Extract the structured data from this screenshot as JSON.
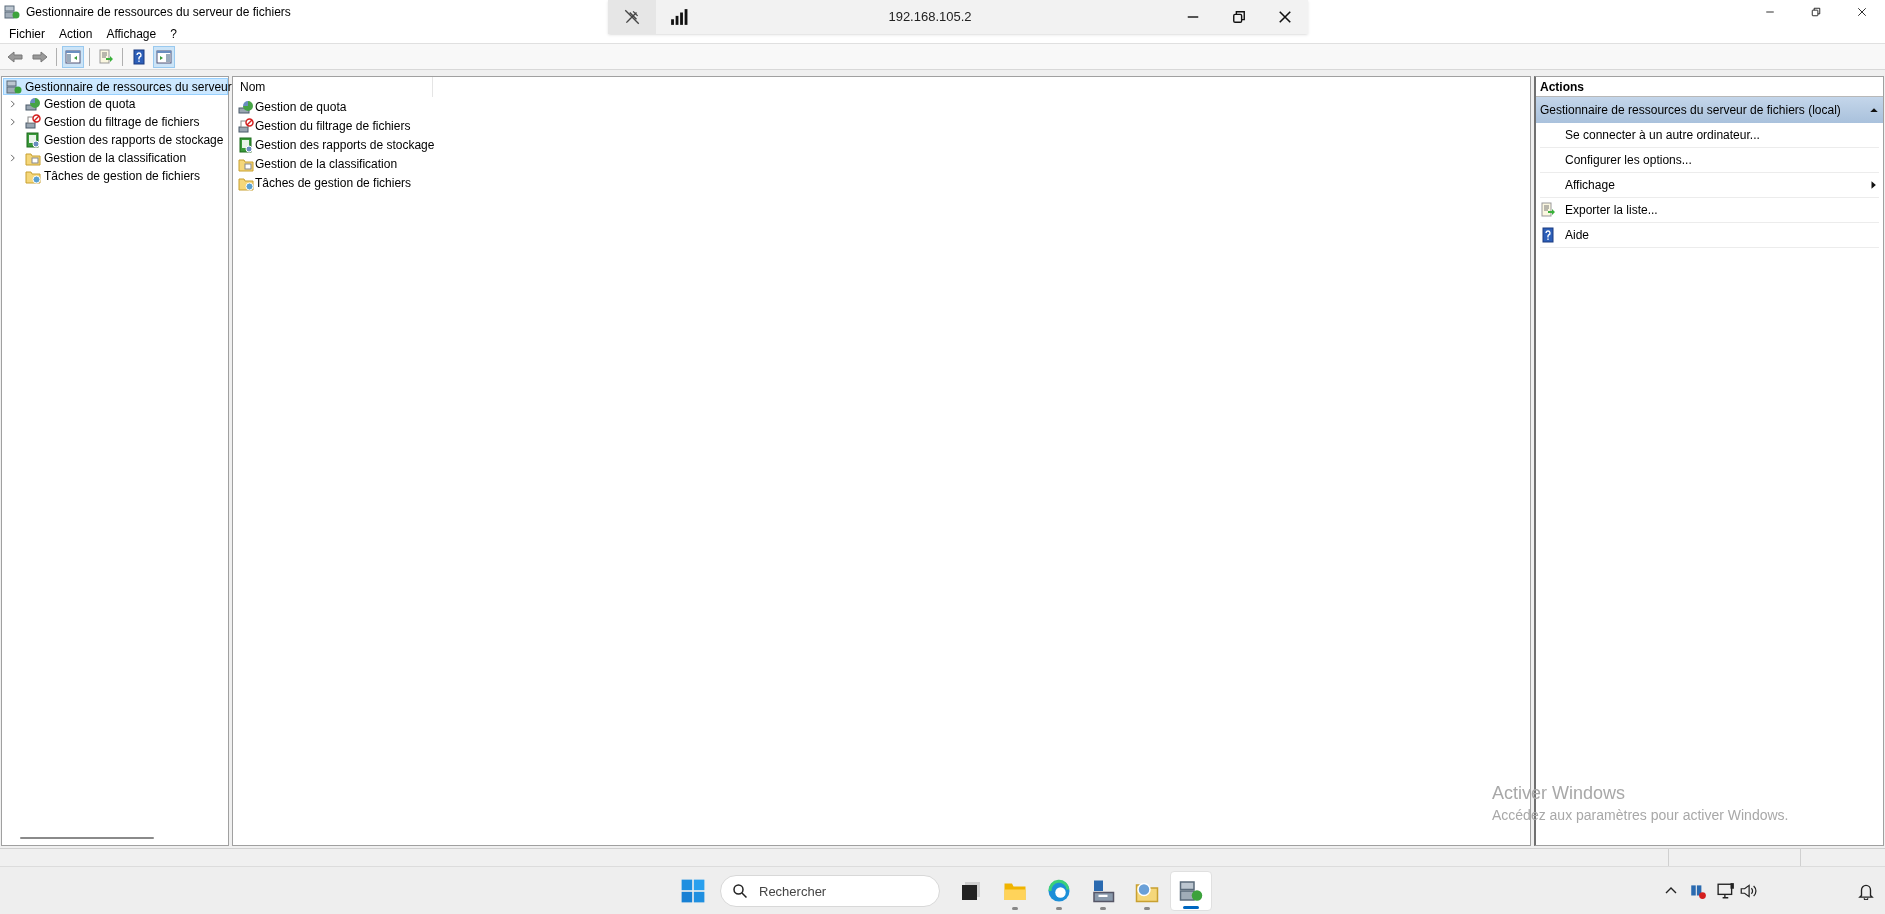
{
  "window": {
    "title": "Gestionnaire de ressources du serveur de fichiers"
  },
  "connection_bar": {
    "address": "192.168.105.2"
  },
  "menu": [
    "Fichier",
    "Action",
    "Affichage",
    "?"
  ],
  "toolbar": [
    {
      "kind": "back",
      "pressed": false
    },
    {
      "kind": "forward",
      "pressed": false
    },
    {
      "kind": "show-tree",
      "pressed": true
    },
    {
      "kind": "export",
      "pressed": false
    },
    {
      "kind": "help",
      "pressed": false
    },
    {
      "kind": "show-actions",
      "pressed": true
    }
  ],
  "tree": {
    "label": "Gestionnaire de ressources du serveur",
    "kind": "server",
    "selected": true,
    "children": [
      {
        "label": "Gestion de quota",
        "kind": "quota",
        "selected": false,
        "expandable": true
      },
      {
        "label": "Gestion du filtrage de fichiers",
        "kind": "filter",
        "selected": false,
        "expandable": true
      },
      {
        "label": "Gestion des rapports de stockage",
        "kind": "report",
        "selected": false,
        "expandable": false
      },
      {
        "label": "Gestion de la classification",
        "kind": "classification",
        "selected": false,
        "expandable": true
      },
      {
        "label": "Tâches de gestion de fichiers",
        "kind": "tasks",
        "selected": false,
        "expandable": false
      }
    ]
  },
  "list": {
    "columns": [
      "Nom"
    ],
    "rows": [
      {
        "name": "Gestion de quota",
        "kind": "quota"
      },
      {
        "name": "Gestion du filtrage de fichiers",
        "kind": "filter"
      },
      {
        "name": "Gestion des rapports de stockage",
        "kind": "report"
      },
      {
        "name": "Gestion de la classification",
        "kind": "classification"
      },
      {
        "name": "Tâches de gestion de fichiers",
        "kind": "tasks"
      }
    ]
  },
  "actions": {
    "title": "Actions",
    "section": {
      "title": "Gestionnaire de ressources du serveur de fichiers (local)",
      "expanded": true
    },
    "items": [
      {
        "label": "Se connecter à un autre ordinateur...",
        "kind": "plain"
      },
      {
        "label": "Configurer les options...",
        "kind": "plain"
      },
      {
        "label": "Affichage",
        "kind": "submenu"
      },
      {
        "label": "Exporter la liste...",
        "kind": "export"
      },
      {
        "label": "Aide",
        "kind": "help"
      }
    ]
  },
  "activation": {
    "title": "Activer Windows",
    "message": "Accédez aux paramètres pour activer Windows."
  },
  "taskbar": {
    "search": {
      "placeholder": "Rechercher"
    },
    "apps": [
      {
        "kind": "task-view",
        "running": false,
        "active": false
      },
      {
        "kind": "folder",
        "running": true,
        "active": false
      },
      {
        "kind": "browser",
        "running": true,
        "active": false
      },
      {
        "kind": "server-manager",
        "running": true,
        "active": false
      },
      {
        "kind": "shared-folder",
        "running": true,
        "active": false
      },
      {
        "kind": "fsrm",
        "running": true,
        "active": true
      }
    ]
  }
}
